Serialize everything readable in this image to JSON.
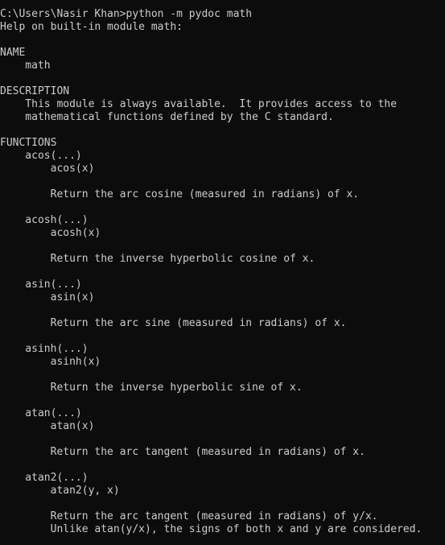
{
  "terminal": {
    "lines": [
      "C:\\Users\\Nasir Khan>python -m pydoc math",
      "Help on built-in module math:",
      "",
      "NAME",
      "    math",
      "",
      "DESCRIPTION",
      "    This module is always available.  It provides access to the",
      "    mathematical functions defined by the C standard.",
      "",
      "FUNCTIONS",
      "    acos(...)",
      "        acos(x)",
      "",
      "        Return the arc cosine (measured in radians) of x.",
      "",
      "    acosh(...)",
      "        acosh(x)",
      "",
      "        Return the inverse hyperbolic cosine of x.",
      "",
      "    asin(...)",
      "        asin(x)",
      "",
      "        Return the arc sine (measured in radians) of x.",
      "",
      "    asinh(...)",
      "        asinh(x)",
      "",
      "        Return the inverse hyperbolic sine of x.",
      "",
      "    atan(...)",
      "        atan(x)",
      "",
      "        Return the arc tangent (measured in radians) of x.",
      "",
      "    atan2(...)",
      "        atan2(y, x)",
      "",
      "        Return the arc tangent (measured in radians) of y/x.",
      "        Unlike atan(y/x), the signs of both x and y are considered."
    ]
  }
}
